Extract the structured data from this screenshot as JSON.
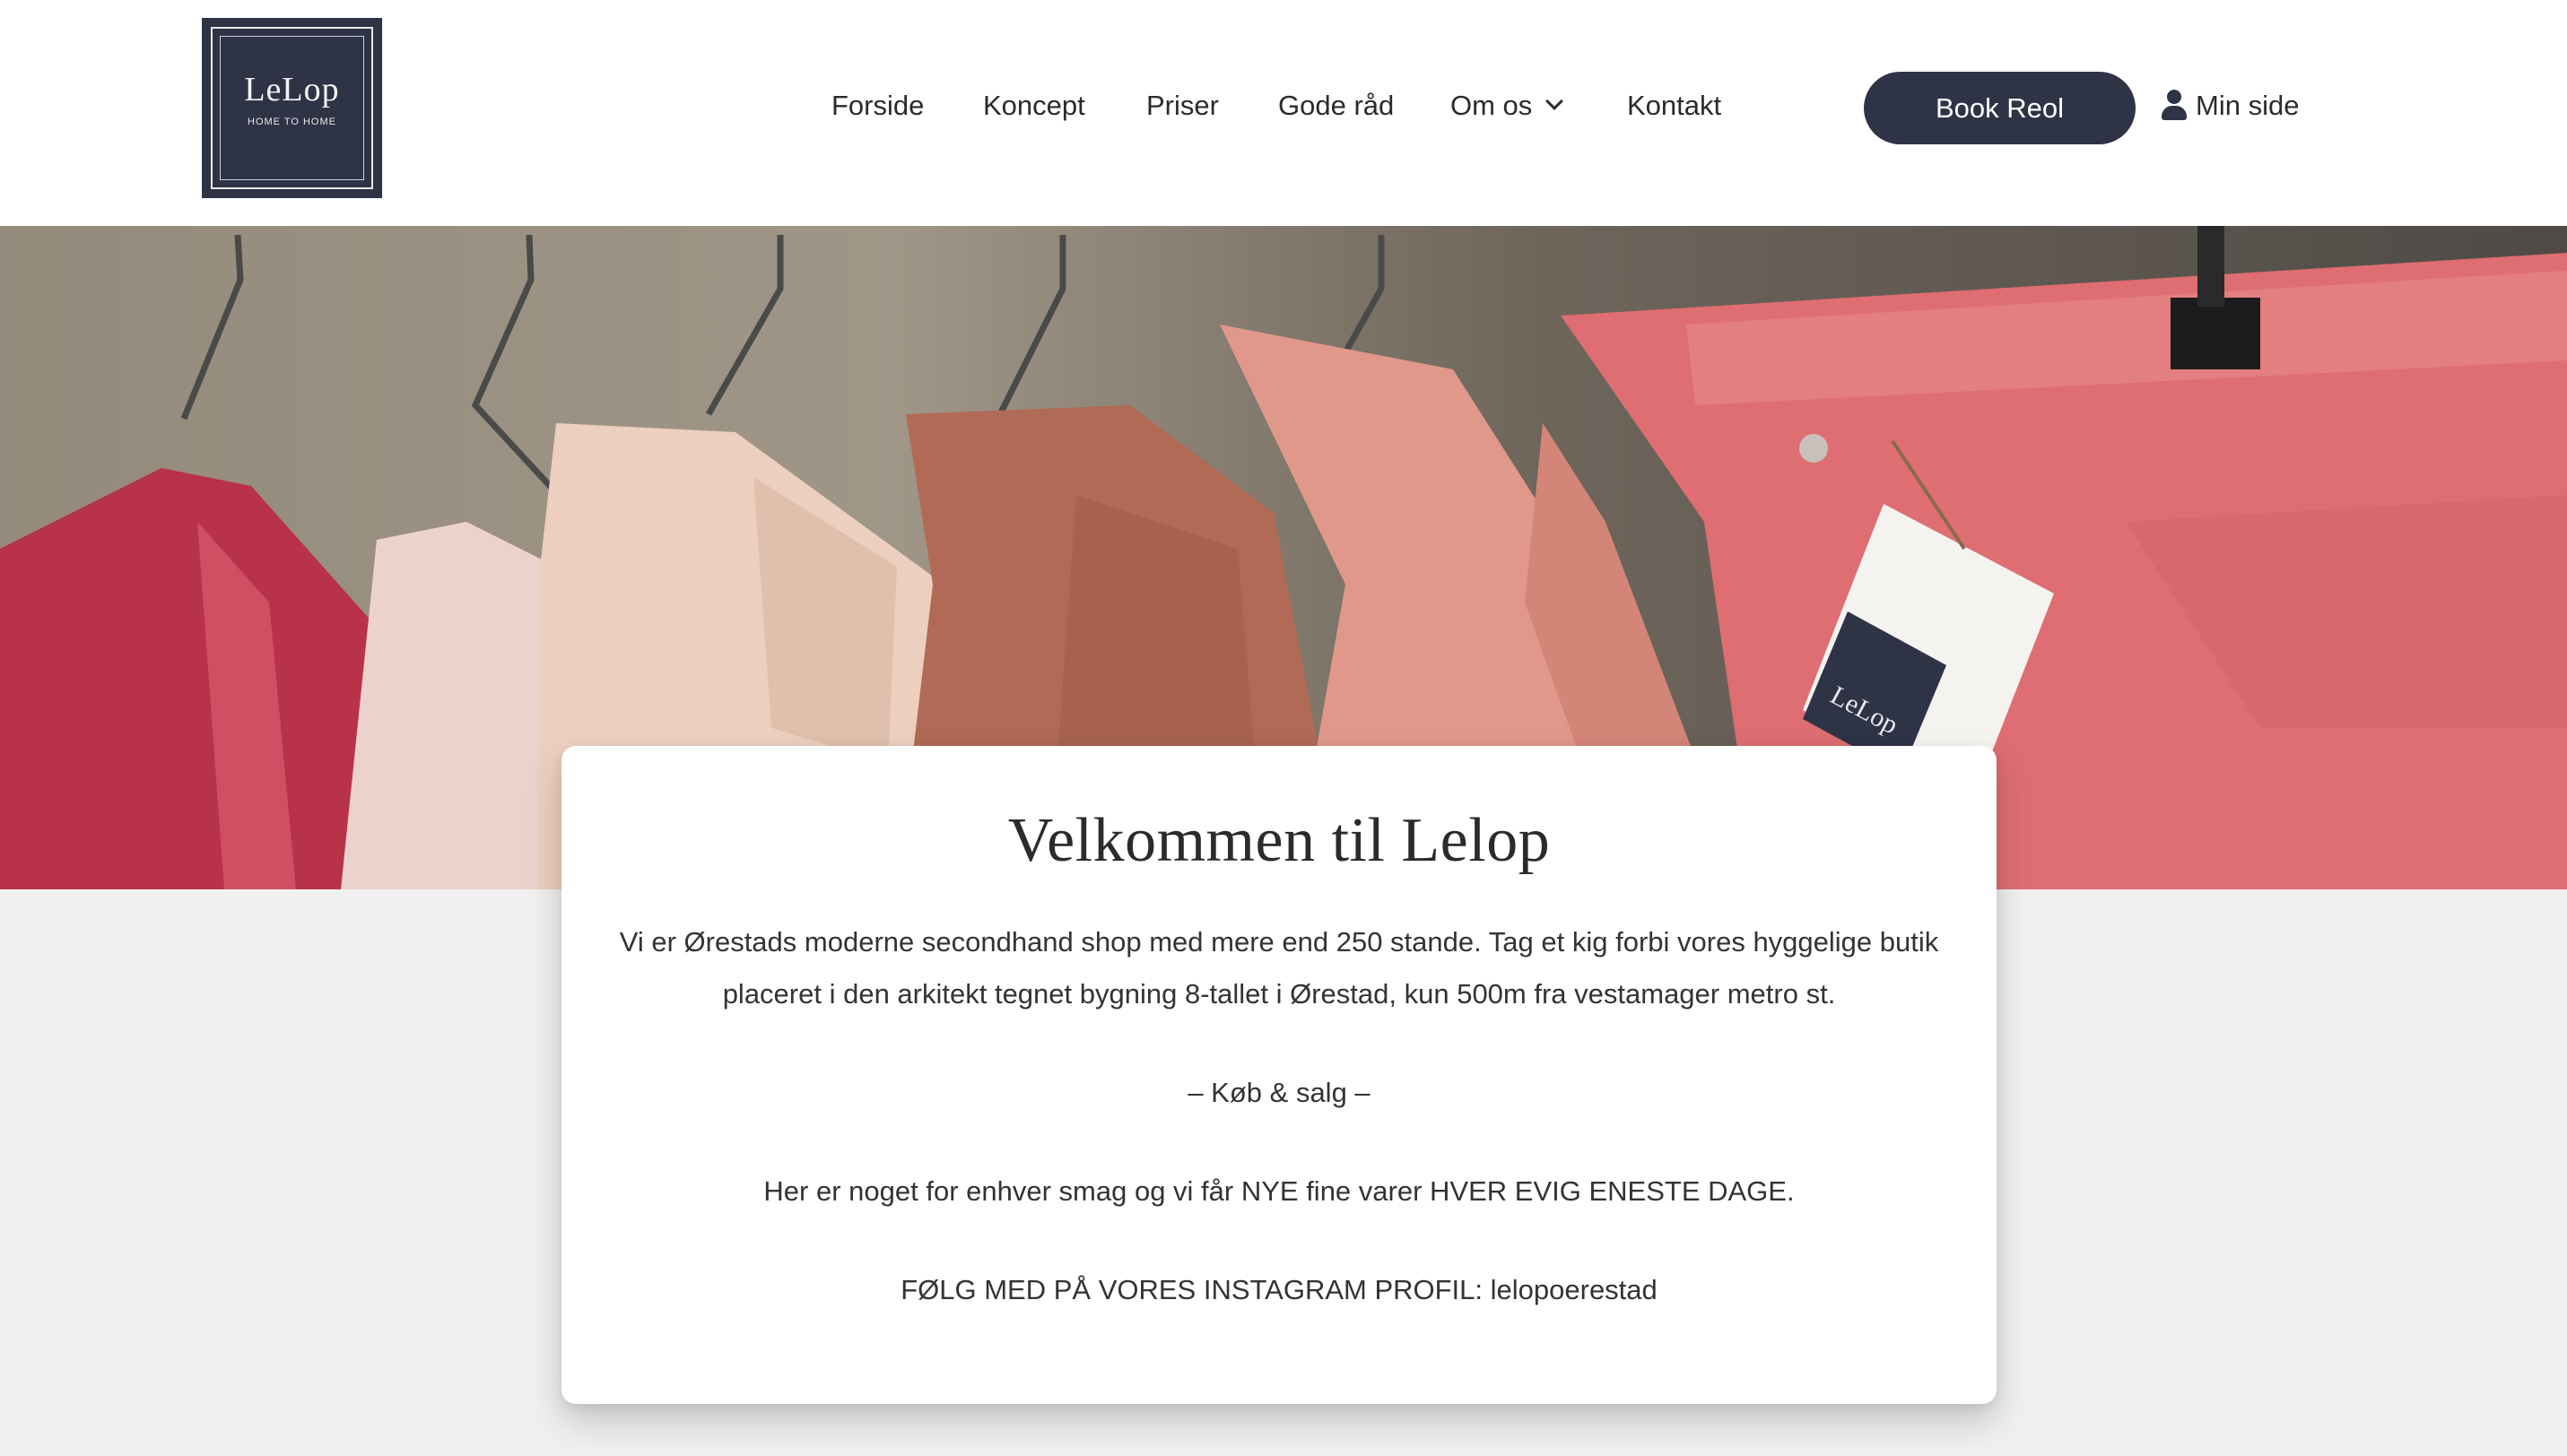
{
  "brand": {
    "logo_title": "LeLop",
    "logo_subtitle": "HOME TO HOME",
    "color_primary": "#2e3446"
  },
  "nav": {
    "items": [
      {
        "label": "Forside"
      },
      {
        "label": "Koncept"
      },
      {
        "label": "Priser"
      },
      {
        "label": "Gode råd"
      },
      {
        "label": "Om os",
        "has_dropdown": true
      },
      {
        "label": "Kontakt"
      }
    ],
    "book_button": "Book Reol",
    "account_link": "Min side",
    "account_icon": "user-icon"
  },
  "hero": {
    "tag_text": "LeLop"
  },
  "welcome": {
    "title": "Velkommen til Lelop",
    "paragraph_1": "Vi er Ørestads moderne secondhand shop med mere end 250 stande. Tag et kig forbi vores hyggelige butik placeret i den arkitekt tegnet bygning 8-tallet i Ørestad, kun 500m fra vestamager metro st.",
    "paragraph_2": "– Køb & salg –",
    "paragraph_3": "Her er noget for enhver smag og vi får NYE fine varer HVER EVIG ENESTE DAGE.",
    "paragraph_4": "FØLG MED PÅ VORES INSTAGRAM PROFIL: lelopoerestad"
  }
}
